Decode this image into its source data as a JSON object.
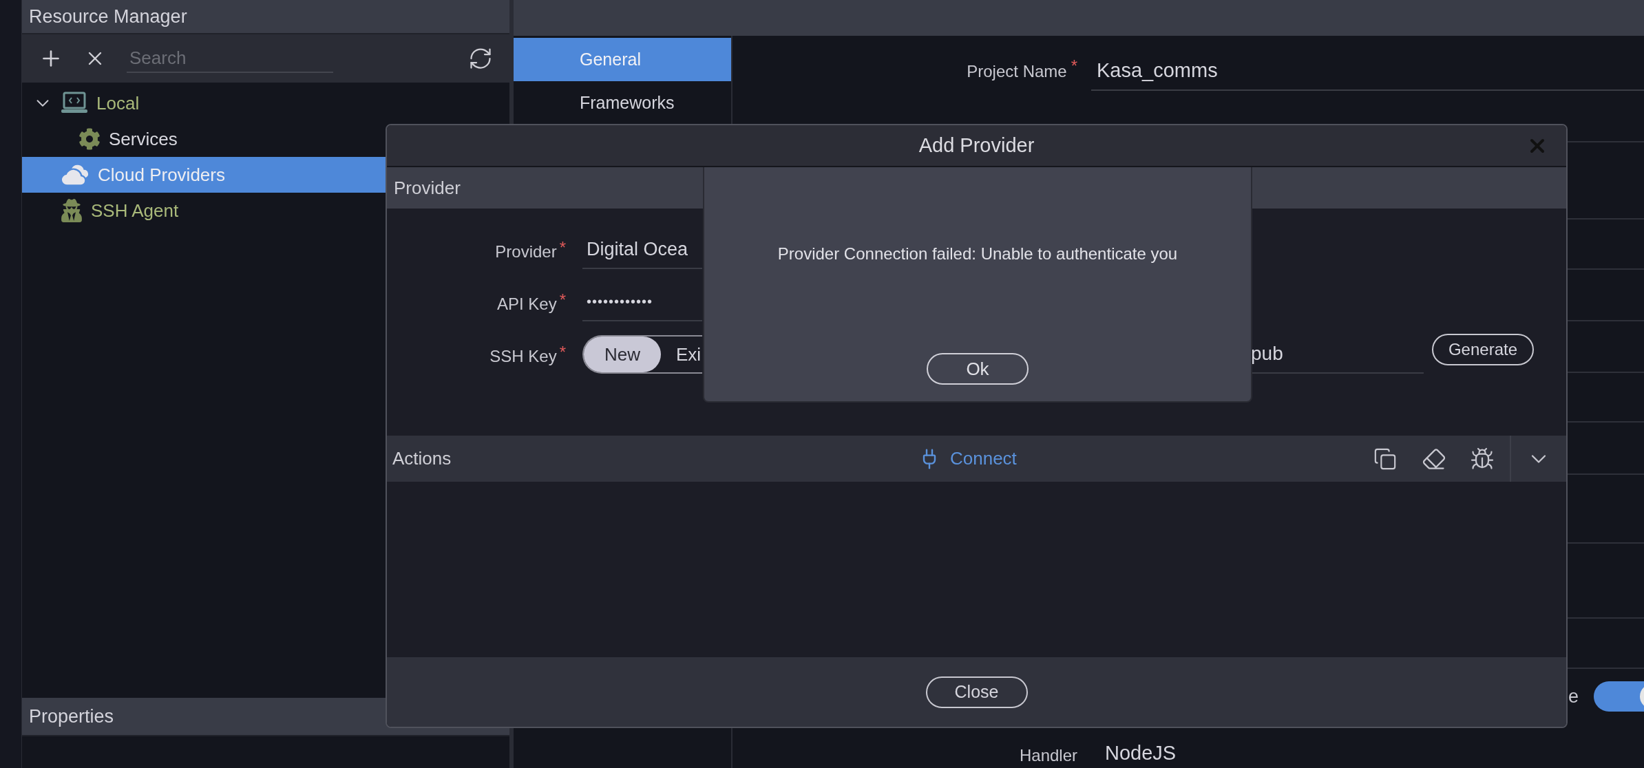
{
  "sidebar": {
    "title": "Resource Manager",
    "search": {
      "placeholder": "Search"
    },
    "tree": [
      {
        "label": "Local",
        "kind": "laptop",
        "color": "#a9b97a",
        "selected": false,
        "expanded": true,
        "children": [
          {
            "label": "Services",
            "kind": "gear",
            "color": "#d9d9e0",
            "selected": false
          }
        ]
      },
      {
        "label": "Cloud Providers",
        "kind": "clouds",
        "color": "#eeeef2",
        "selected": true
      },
      {
        "label": "SSH Agent",
        "kind": "spy",
        "color": "#a9b97a",
        "selected": false
      }
    ],
    "properties_title": "Properties"
  },
  "settings": {
    "tabs": [
      {
        "label": "General",
        "selected": true
      },
      {
        "label": "Frameworks",
        "selected": false
      }
    ],
    "project_name": {
      "label": "Project Name",
      "mark": "*",
      "value": "Kasa_comms"
    },
    "toggle": {
      "label": "e",
      "on": true
    },
    "handler": {
      "label": "Handler",
      "value": "NodeJS"
    }
  },
  "dialog": {
    "title": "Add Provider",
    "section": "Provider",
    "fields": [
      {
        "label": "Provider",
        "kind": "text",
        "mark": "*",
        "value": "Digital Ocea"
      },
      {
        "label": "API Key",
        "kind": "password",
        "mark": "*",
        "value": "••••••••••••"
      },
      {
        "label": "SSH Key",
        "kind": "segmented",
        "mark": "*",
        "options": [
          {
            "label": "New",
            "selected": true
          },
          {
            "label": "Exi",
            "selected": false
          }
        ],
        "file": "pub",
        "button": "Generate"
      }
    ],
    "actions": {
      "title": "Actions",
      "connect": "Connect"
    },
    "close": "Close"
  },
  "alert": {
    "message": "Provider Connection failed: Unable to authenticate you",
    "button": "Ok"
  }
}
